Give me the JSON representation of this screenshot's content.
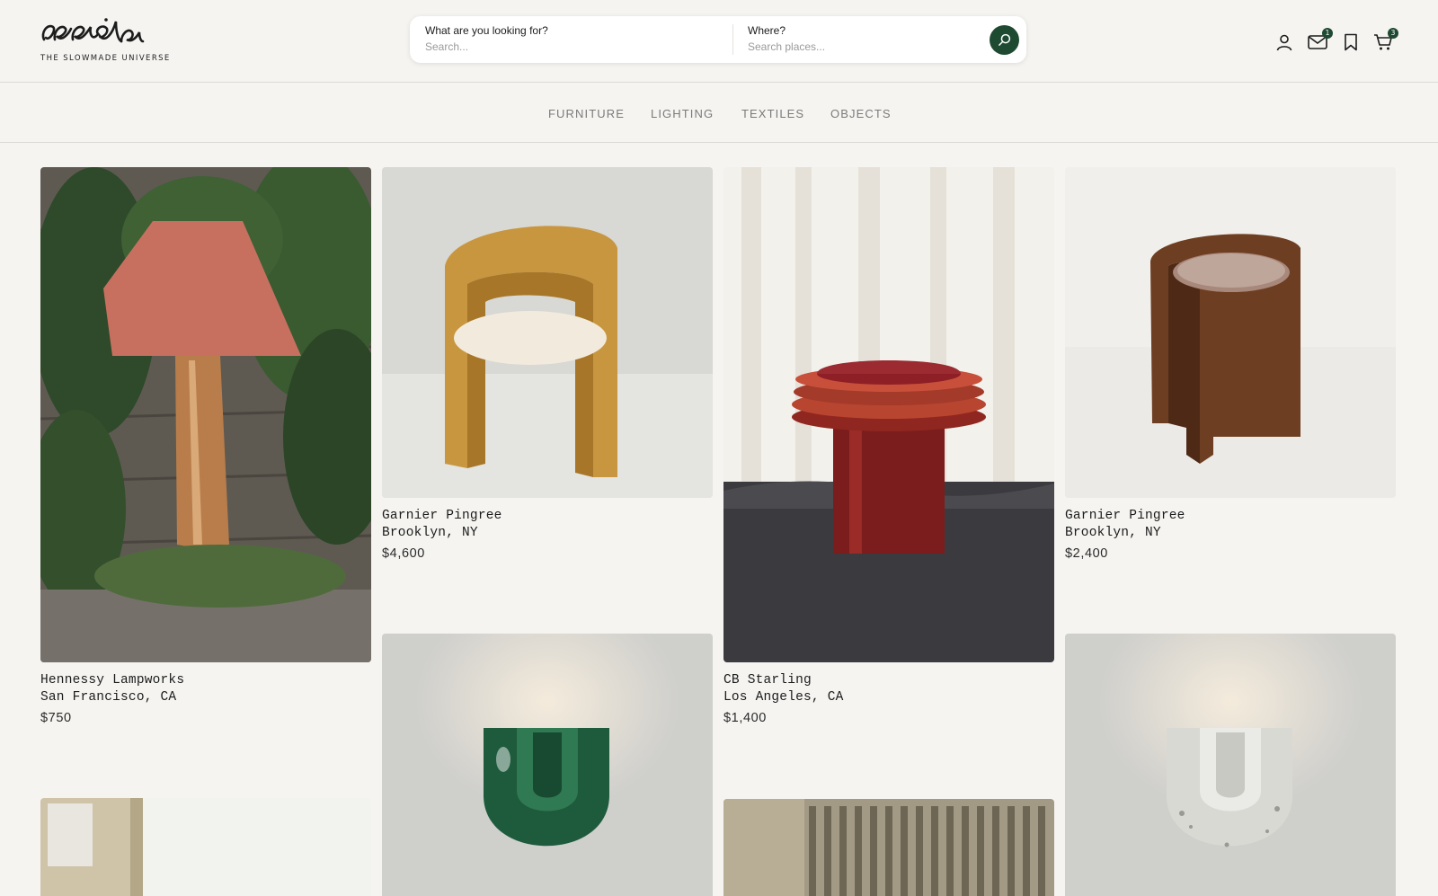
{
  "brand": {
    "tagline": "THE SLOWMADE UNIVERSE",
    "accent_color": "#1f4a32"
  },
  "search": {
    "what_label": "What are you looking for?",
    "what_placeholder": "Search...",
    "where_label": "Where?",
    "where_placeholder": "Search places..."
  },
  "header_icons": {
    "messages_badge": "1",
    "cart_badge": "3"
  },
  "categories": [
    "FURNITURE",
    "LIGHTING",
    "TEXTILES",
    "OBJECTS"
  ],
  "products": [
    {
      "maker": "Hennessy Lampworks",
      "location": "San Francisco, CA",
      "price": "$750"
    },
    {
      "maker": "Garnier Pingree",
      "location": "Brooklyn, NY",
      "price": "$4,600"
    },
    {
      "maker": "CB Starling",
      "location": "Los Angeles, CA",
      "price": "$1,400"
    },
    {
      "maker": "Garnier Pingree",
      "location": "Brooklyn, NY",
      "price": "$2,400"
    }
  ]
}
